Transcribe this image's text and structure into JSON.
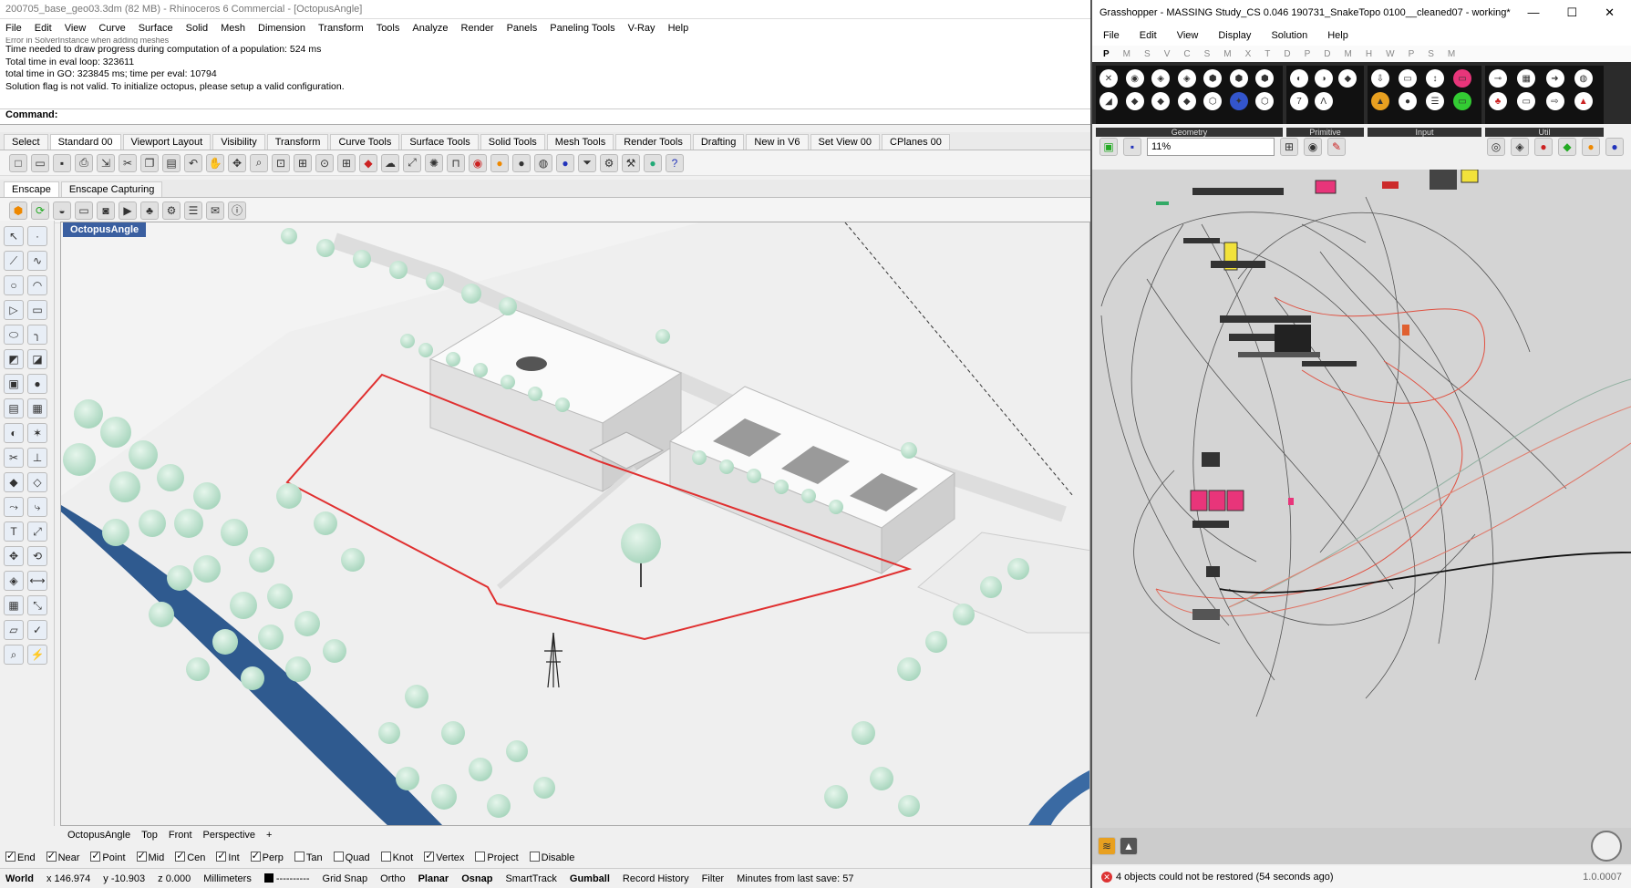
{
  "rhino": {
    "title": "200705_base_geo03.3dm (82 MB) - Rhinoceros 6 Commercial - [OctopusAngle]",
    "menu": [
      "File",
      "Edit",
      "View",
      "Curve",
      "Surface",
      "Solid",
      "Mesh",
      "Dimension",
      "Transform",
      "Tools",
      "Analyze",
      "Render",
      "Panels",
      "Paneling Tools",
      "V-Ray",
      "Help"
    ],
    "history": [
      "Error in SolverInstance when adding meshes",
      "Time needed to draw progress during computation of a population: 524 ms",
      "Total time in eval loop: 323611",
      "total time in GO: 323845 ms; time per eval: 10794",
      "Solution flag is not valid. To initialize octopus, please setup a valid configuration."
    ],
    "command_label": "Command:",
    "toolbar_tabs": [
      "Select",
      "Standard 00",
      "Viewport Layout",
      "Visibility",
      "Transform",
      "Curve Tools",
      "Surface Tools",
      "Solid Tools",
      "Mesh Tools",
      "Render Tools",
      "Drafting",
      "New in V6",
      "Set View 00",
      "CPlanes 00"
    ],
    "enscape_tabs": [
      "Enscape",
      "Enscape Capturing"
    ],
    "viewport_name": "OctopusAngle",
    "viewport_tabs": [
      "OctopusAngle",
      "Top",
      "Front",
      "Perspective",
      "+"
    ],
    "osnaps": [
      {
        "label": "End",
        "on": true
      },
      {
        "label": "Near",
        "on": true
      },
      {
        "label": "Point",
        "on": true
      },
      {
        "label": "Mid",
        "on": true
      },
      {
        "label": "Cen",
        "on": true
      },
      {
        "label": "Int",
        "on": true
      },
      {
        "label": "Perp",
        "on": true
      },
      {
        "label": "Tan",
        "on": false
      },
      {
        "label": "Quad",
        "on": false
      },
      {
        "label": "Knot",
        "on": false
      },
      {
        "label": "Vertex",
        "on": true
      },
      {
        "label": "Project",
        "on": false
      },
      {
        "label": "Disable",
        "on": false
      }
    ],
    "status": {
      "cplane": "World",
      "x": "x 146.974",
      "y": "y -10.903",
      "z": "z 0.000",
      "units": "Millimeters",
      "layer": "----------",
      "grid_snap": "Grid Snap",
      "ortho": "Ortho",
      "planar": "Planar",
      "osnap": "Osnap",
      "smarttrack": "SmartTrack",
      "gumball": "Gumball",
      "record_history": "Record History",
      "filter": "Filter",
      "save_info": "Minutes from last save: 57"
    }
  },
  "grasshopper": {
    "title": "Grasshopper - MASSING Study_CS 0.046 190731_SnakeTopo 0100__cleaned07 - working*",
    "window_buttons": [
      "—",
      "☐",
      "✕"
    ],
    "menu": [
      "File",
      "Edit",
      "View",
      "Display",
      "Solution",
      "Help"
    ],
    "component_tabs": [
      "P",
      "M",
      "S",
      "V",
      "C",
      "S",
      "M",
      "X",
      "T",
      "D",
      "P",
      "D",
      "M",
      "H",
      "W",
      "P",
      "S",
      "M"
    ],
    "ribbon_groups": [
      "Geometry",
      "Primitive",
      "Input",
      "Util"
    ],
    "zoom": "11%",
    "status_message": "4 objects could not be restored (54 seconds ago)",
    "version": "1.0.0007"
  },
  "colors": {
    "accent": "#3a5fa0",
    "boundary": "#e03030",
    "trees": "#bfe3cf",
    "river": "#2f5a8f",
    "gh_pink": "#e8357a",
    "gh_yellow": "#f2e23a"
  }
}
